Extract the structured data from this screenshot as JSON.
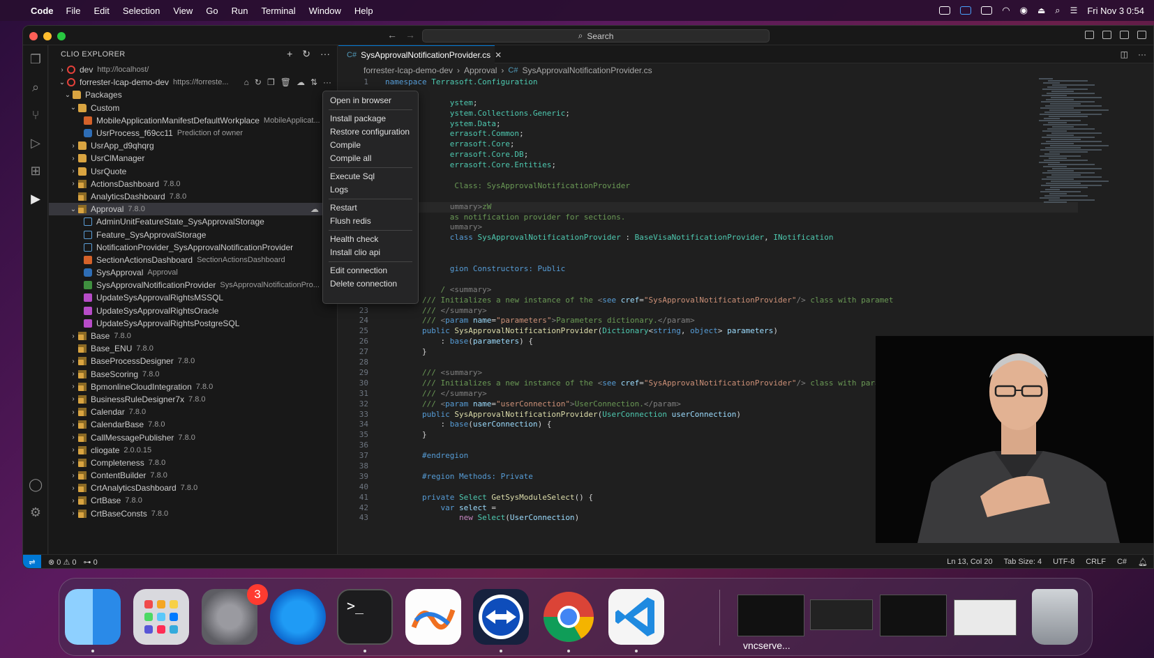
{
  "menubar": {
    "app_name": "Code",
    "items": [
      "File",
      "Edit",
      "Selection",
      "View",
      "Go",
      "Run",
      "Terminal",
      "Window",
      "Help"
    ],
    "clock": "Fri Nov 3  0:54"
  },
  "titlebar": {
    "search_label": "Search"
  },
  "sidebar": {
    "title": "CLIO EXPLORER",
    "rows": [
      {
        "indent": 0,
        "chev": "›",
        "icon": "red-ring",
        "name": "dev",
        "desc": "http://localhost/"
      },
      {
        "indent": 0,
        "chev": "⌄",
        "icon": "red-ring",
        "name": "forrester-lcap-demo-dev",
        "desc": "https://forreste..."
      },
      {
        "indent": 1,
        "chev": "⌄",
        "icon": "folder",
        "name": "Packages",
        "desc": ""
      },
      {
        "indent": 2,
        "chev": "⌄",
        "icon": "folder",
        "name": "Custom",
        "desc": ""
      },
      {
        "indent": 3,
        "chev": "",
        "icon": "orange",
        "name": "MobileApplicationManifestDefaultWorkplace",
        "desc": "MobileApplicat..."
      },
      {
        "indent": 3,
        "chev": "",
        "icon": "blue",
        "name": "UsrProcess_f69cc11",
        "desc": "Prediction of owner"
      },
      {
        "indent": 2,
        "chev": "›",
        "icon": "folder",
        "name": "UsrApp_d9qhqrg",
        "desc": ""
      },
      {
        "indent": 2,
        "chev": "›",
        "icon": "folder",
        "name": "UsrClManager",
        "desc": ""
      },
      {
        "indent": 2,
        "chev": "›",
        "icon": "folder",
        "name": "UsrQuote",
        "desc": ""
      },
      {
        "indent": 2,
        "chev": "›",
        "icon": "pkg",
        "name": "ActionsDashboard",
        "desc": "7.8.0"
      },
      {
        "indent": 2,
        "chev": "",
        "icon": "pkg",
        "name": "AnalyticsDashboard",
        "desc": "7.8.0"
      },
      {
        "indent": 2,
        "chev": "⌄",
        "icon": "pkg",
        "name": "Approval",
        "desc": "7.8.0",
        "selected": true
      },
      {
        "indent": 3,
        "chev": "",
        "icon": "file",
        "name": "AdminUnitFeatureState_SysApprovalStorage",
        "desc": ""
      },
      {
        "indent": 3,
        "chev": "",
        "icon": "file",
        "name": "Feature_SysApprovalStorage",
        "desc": ""
      },
      {
        "indent": 3,
        "chev": "",
        "icon": "file",
        "name": "NotificationProvider_SysApprovalNotificationProvider",
        "desc": ""
      },
      {
        "indent": 3,
        "chev": "",
        "icon": "orange",
        "name": "SectionActionsDashboard",
        "desc": "SectionActionsDashboard"
      },
      {
        "indent": 3,
        "chev": "",
        "icon": "blue",
        "name": "SysApproval",
        "desc": "Approval"
      },
      {
        "indent": 3,
        "chev": "",
        "icon": "cs",
        "name": "SysApprovalNotificationProvider",
        "desc": "SysApprovalNotificationPro..."
      },
      {
        "indent": 3,
        "chev": "",
        "icon": "sql",
        "name": "UpdateSysApprovalRightsMSSQL",
        "desc": ""
      },
      {
        "indent": 3,
        "chev": "",
        "icon": "sql",
        "name": "UpdateSysApprovalRightsOracle",
        "desc": ""
      },
      {
        "indent": 3,
        "chev": "",
        "icon": "sql",
        "name": "UpdateSysApprovalRightsPostgreSQL",
        "desc": ""
      },
      {
        "indent": 2,
        "chev": "›",
        "icon": "pkg",
        "name": "Base",
        "desc": "7.8.0"
      },
      {
        "indent": 2,
        "chev": "",
        "icon": "pkg",
        "name": "Base_ENU",
        "desc": "7.8.0"
      },
      {
        "indent": 2,
        "chev": "›",
        "icon": "pkg",
        "name": "BaseProcessDesigner",
        "desc": "7.8.0"
      },
      {
        "indent": 2,
        "chev": "›",
        "icon": "pkg",
        "name": "BaseScoring",
        "desc": "7.8.0"
      },
      {
        "indent": 2,
        "chev": "›",
        "icon": "pkg",
        "name": "BpmonlineCloudIntegration",
        "desc": "7.8.0"
      },
      {
        "indent": 2,
        "chev": "›",
        "icon": "pkg",
        "name": "BusinessRuleDesigner7x",
        "desc": "7.8.0"
      },
      {
        "indent": 2,
        "chev": "›",
        "icon": "pkg",
        "name": "Calendar",
        "desc": "7.8.0"
      },
      {
        "indent": 2,
        "chev": "›",
        "icon": "pkg",
        "name": "CalendarBase",
        "desc": "7.8.0"
      },
      {
        "indent": 2,
        "chev": "›",
        "icon": "pkg",
        "name": "CallMessagePublisher",
        "desc": "7.8.0"
      },
      {
        "indent": 2,
        "chev": "›",
        "icon": "pkg",
        "name": "cliogate",
        "desc": "2.0.0.15"
      },
      {
        "indent": 2,
        "chev": "›",
        "icon": "pkg",
        "name": "Completeness",
        "desc": "7.8.0"
      },
      {
        "indent": 2,
        "chev": "›",
        "icon": "pkg",
        "name": "ContentBuilder",
        "desc": "7.8.0"
      },
      {
        "indent": 2,
        "chev": "›",
        "icon": "pkg",
        "name": "CrtAnalyticsDashboard",
        "desc": "7.8.0"
      },
      {
        "indent": 2,
        "chev": "›",
        "icon": "pkg",
        "name": "CrtBase",
        "desc": "7.8.0"
      },
      {
        "indent": 2,
        "chev": "›",
        "icon": "pkg",
        "name": "CrtBaseConsts",
        "desc": "7.8.0"
      }
    ]
  },
  "context_menu": {
    "groups": [
      [
        "Open in browser"
      ],
      [
        "Install package",
        "Restore configuration",
        "Compile",
        "Compile all"
      ],
      [
        "Execute Sql",
        "Logs"
      ],
      [
        "Restart",
        "Flush redis"
      ],
      [
        "Health check",
        "Install clio api"
      ],
      [
        "Edit connection",
        "Delete connection"
      ]
    ]
  },
  "editor": {
    "tab_label": "SysApprovalNotificationProvider.cs",
    "breadcrumb": [
      "forrester-lcap-demo-dev",
      "Approval",
      "SysApprovalNotificationProvider.cs"
    ]
  },
  "statusbar": {
    "errors": "0",
    "warnings": "0",
    "ports": "0",
    "position": "Ln 13, Col 20",
    "tab_size": "Tab Size: 4",
    "encoding": "UTF-8",
    "eol": "CRLF",
    "language": "C#"
  },
  "dock": {
    "badge_count": "3",
    "vnc_label": "vncserve..."
  }
}
